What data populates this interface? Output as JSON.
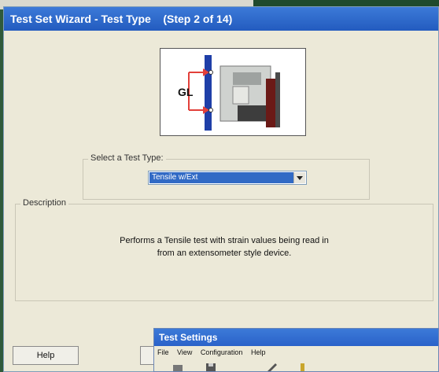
{
  "wizard": {
    "title": "Test Set Wizard - Test Type",
    "step": "(Step 2 of 14)",
    "diagram_label": "GL",
    "select_label": "Select a Test Type:",
    "selected_type": "Tensile w/Ext",
    "description_label": "Description",
    "description_line1": "Performs a Tensile test with strain values being read in",
    "description_line2": "from an extensometer style device.",
    "help_button": "Help"
  },
  "test_settings": {
    "title": "Test Settings",
    "menu": [
      "File",
      "View",
      "Configuration",
      "Help"
    ]
  },
  "colors": {
    "titlebar": "#235bbf",
    "selection": "#316ac5",
    "dialog_bg": "#ece9d8",
    "diagram_arrow": "#e2403a"
  }
}
